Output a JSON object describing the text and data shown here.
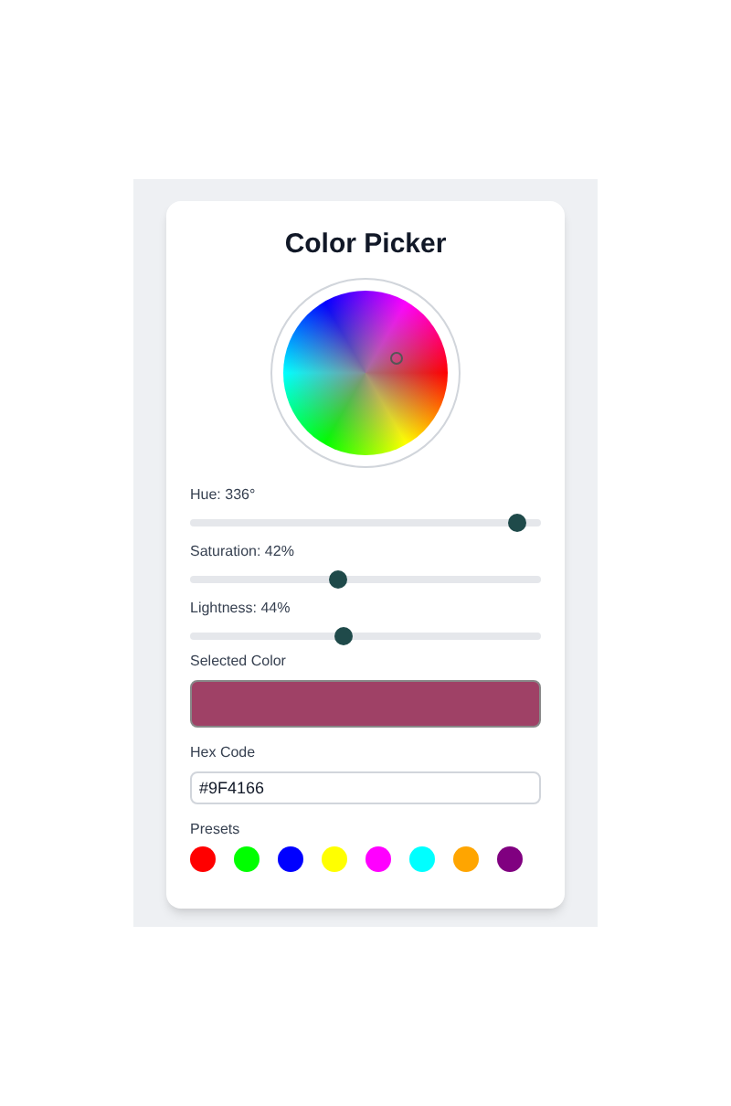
{
  "title": "Color Picker",
  "sliders": [
    {
      "label": "Hue: 336°",
      "level": 0.933
    },
    {
      "label": "Saturation: 42%",
      "level": 0.42
    },
    {
      "label": "Lightness: 44%",
      "level": 0.44
    }
  ],
  "selected": {
    "label": "Selected Color",
    "color": "#9f4166"
  },
  "hex": {
    "label": "Hex Code",
    "value": "#9F4166"
  },
  "presets": {
    "label": "Presets",
    "items": [
      {
        "color": "#ff0000"
      },
      {
        "color": "#00ff00"
      },
      {
        "color": "#0000ff"
      },
      {
        "color": "#ffff00"
      },
      {
        "color": "#ff00ff"
      },
      {
        "color": "#00ffff"
      },
      {
        "color": "#ffa500"
      },
      {
        "color": "#800080"
      }
    ]
  }
}
